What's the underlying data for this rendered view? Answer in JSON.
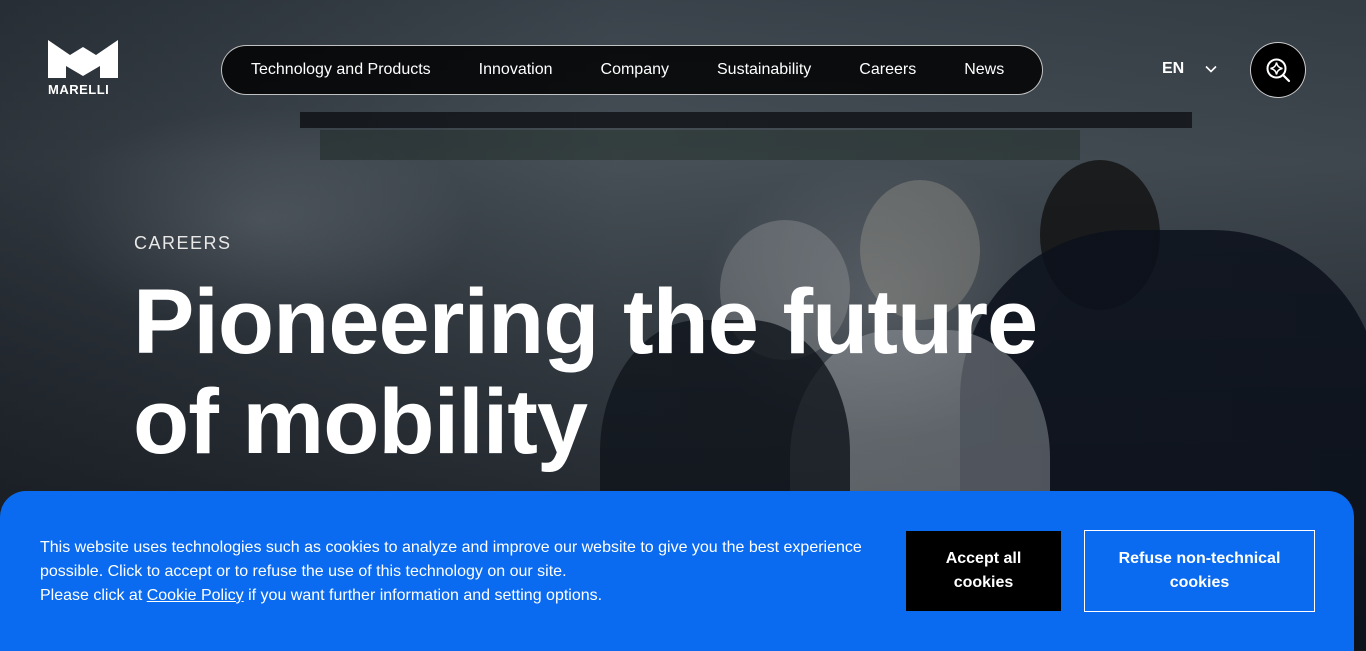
{
  "brand": {
    "logo_text": "MARELLI"
  },
  "nav": {
    "items": [
      {
        "label": "Technology and Products"
      },
      {
        "label": "Innovation"
      },
      {
        "label": "Company"
      },
      {
        "label": "Sustainability"
      },
      {
        "label": "Careers"
      },
      {
        "label": "News"
      }
    ]
  },
  "language": {
    "selected": "EN",
    "icon": "chevron-down-icon"
  },
  "search": {
    "icon": "ai-search-icon"
  },
  "hero": {
    "eyebrow": "CAREERS",
    "headline_line1": "Pioneering the future",
    "headline_line2": "of mobility"
  },
  "cookie_banner": {
    "text_line1": "This website uses technologies such as cookies to analyze and improve our website to give you the best experience possible. Click to accept or to refuse the use of this technology on our site.",
    "text_prefix": "Please click at ",
    "policy_link": "Cookie Policy",
    "text_suffix": " if you want further information and setting options.",
    "accept_label": "Accept all cookies",
    "refuse_label": "Refuse non-technical cookies",
    "background_color": "#0a6bf0"
  }
}
